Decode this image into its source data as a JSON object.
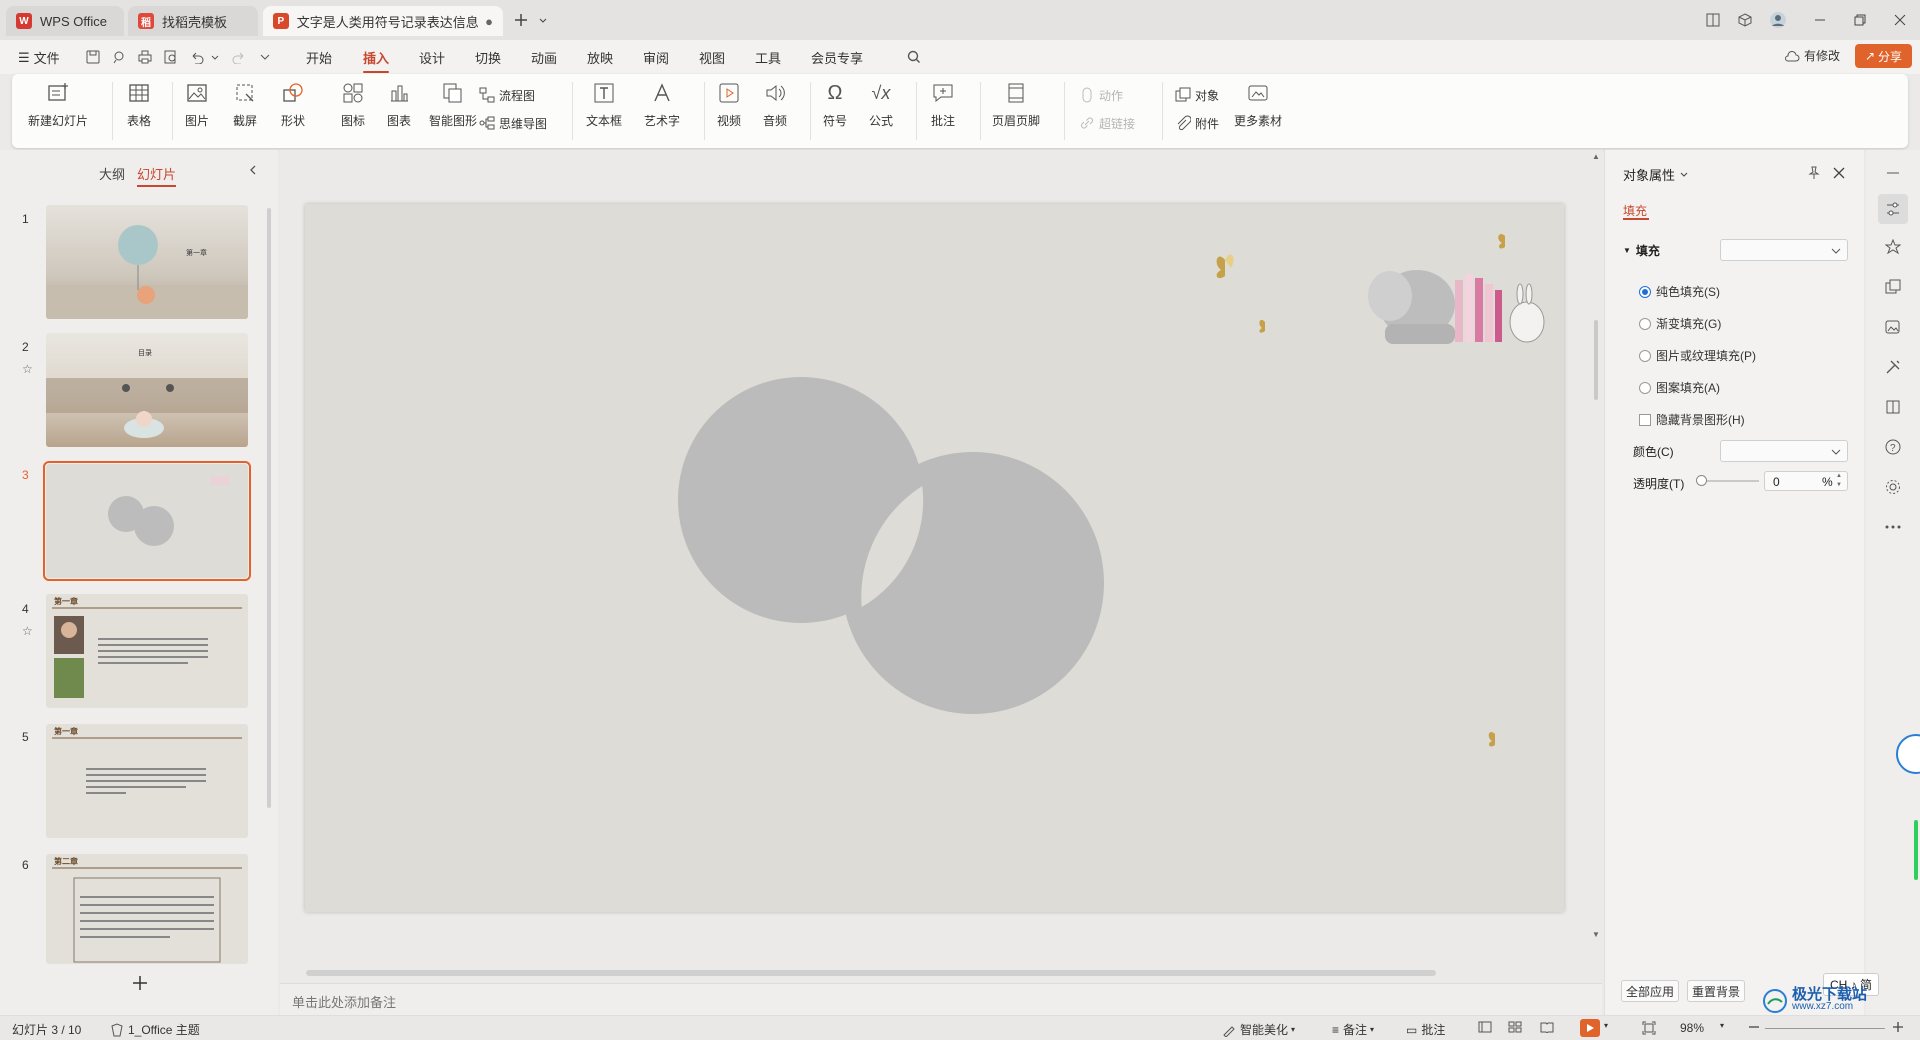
{
  "titlebar": {
    "tabs": [
      {
        "label": "WPS Office",
        "icon": "wps-logo-icon"
      },
      {
        "label": "找稻壳模板",
        "icon": "docer-logo-icon"
      },
      {
        "label": "文字是人类用符号记录表达信息以",
        "icon": "presentation-file-icon",
        "active": true
      }
    ],
    "brand_color": "#c8482f"
  },
  "menubar": {
    "file_label": "文件",
    "items": [
      "开始",
      "插入",
      "设计",
      "切换",
      "动画",
      "放映",
      "审阅",
      "视图",
      "工具",
      "会员专享"
    ],
    "active_item": "插入",
    "modified_label": "有修改",
    "share_label": "分享"
  },
  "ribbon": {
    "new_slide": "新建幻灯片",
    "table": "表格",
    "picture": "图片",
    "screenshot": "截屏",
    "shape": "形状",
    "icon": "图标",
    "chart": "图表",
    "smart_graphic": "智能图形",
    "flowchart": "流程图",
    "mindmap": "思维导图",
    "textbox": "文本框",
    "wordart": "艺术字",
    "video": "视频",
    "audio": "音频",
    "symbol": "符号",
    "formula": "公式",
    "comment": "批注",
    "header_footer": "页眉页脚",
    "action": "动作",
    "hyperlink": "超链接",
    "object": "对象",
    "attachment": "附件",
    "more_material": "更多素材"
  },
  "leftpanel": {
    "tab_outline": "大纲",
    "tab_slides": "幻灯片",
    "slides": [
      {
        "num": "1",
        "title": "第一章"
      },
      {
        "num": "2",
        "title": "目录"
      },
      {
        "num": "3",
        "title": ""
      },
      {
        "num": "4",
        "title": "第一章"
      },
      {
        "num": "5",
        "title": "第一章"
      },
      {
        "num": "6",
        "title": "第二章"
      }
    ],
    "selected_slide": 3
  },
  "notes": {
    "placeholder": "单击此处添加备注"
  },
  "rightpanel": {
    "title": "对象属性",
    "tab_fill": "填充",
    "section_fill": "填充",
    "options": [
      "纯色填充(S)",
      "渐变填充(G)",
      "图片或纹理填充(P)",
      "图案填充(A)"
    ],
    "selected_option": 0,
    "hide_bg_label": "隐藏背景图形(H)",
    "color_label": "颜色(C)",
    "transparency_label": "透明度(T)",
    "transparency_value": "0",
    "transparency_unit": "%",
    "apply_all": "全部应用",
    "reset_bg": "重置背景"
  },
  "statusbar": {
    "slide_info": "幻灯片 3 / 10",
    "theme": "1_Office 主题",
    "beautify": "智能美化",
    "notes": "备注",
    "comment": "批注",
    "zoom": "98%",
    "ime": "CH ♪ 简"
  },
  "watermark": {
    "text": "极光下载站",
    "url": "www.xz7.com"
  }
}
